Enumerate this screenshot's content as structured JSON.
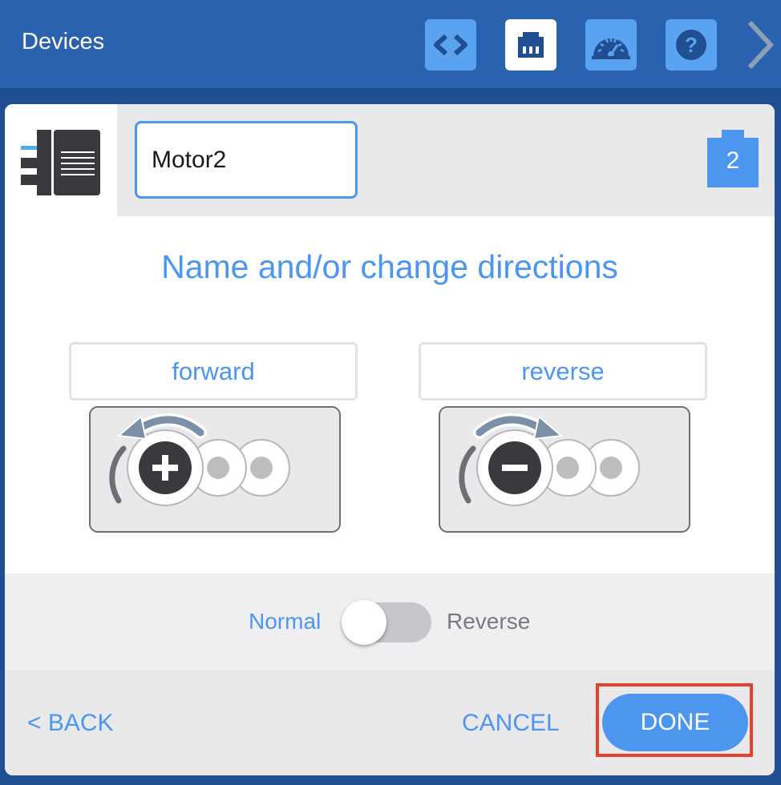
{
  "header": {
    "title": "Devices",
    "toolbar": [
      {
        "icon": "code-icon",
        "active": false
      },
      {
        "icon": "devices-port-icon",
        "active": true
      },
      {
        "icon": "dashboard-gauge-icon",
        "active": false
      },
      {
        "icon": "help-icon",
        "glyph": "?",
        "active": false
      }
    ],
    "next_icon": "chevron-right-icon"
  },
  "device": {
    "icon": "motor-icon",
    "name": "Motor2",
    "port": "2"
  },
  "heading": "Name and/or change directions",
  "directions": {
    "forward_label": "forward",
    "reverse_label": "reverse",
    "forward_icon": "rotate-counterclockwise-plus-icon",
    "reverse_icon": "rotate-clockwise-minus-icon"
  },
  "toggle": {
    "left_label": "Normal",
    "right_label": "Reverse",
    "state": "Normal"
  },
  "footer": {
    "back_label": "< BACK",
    "cancel_label": "CANCEL",
    "done_label": "DONE"
  },
  "colors": {
    "header_bg": "#2a62b0",
    "accent": "#4c96f0",
    "highlight": "#e4422d"
  }
}
